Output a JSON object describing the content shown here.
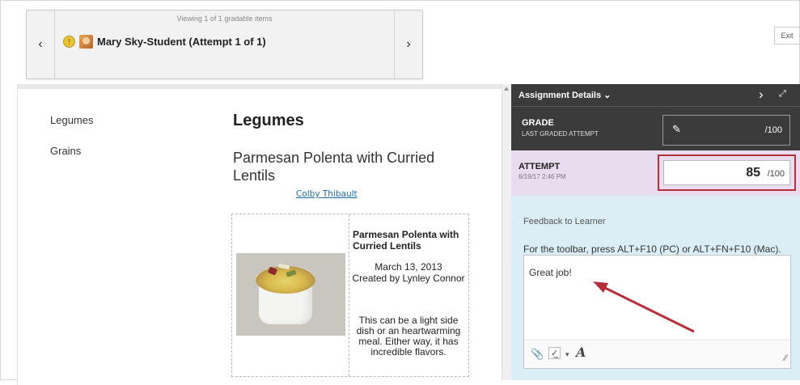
{
  "navigator": {
    "viewing_text": "Viewing 1 of 1 gradable items",
    "student_name": "Mary Sky-Student (Attempt 1 of 1)",
    "prev_icon": "‹",
    "next_icon": "›"
  },
  "exit_label": "Exit",
  "document": {
    "side_links": [
      "Legumes",
      "Grains"
    ],
    "title": "Legumes",
    "subtitle": "Parmesan Polenta with Curried Lentils",
    "author": "Colby Thibault",
    "recipe": {
      "name": "Parmesan Polenta with Curried Lentils",
      "date": "March 13, 2013",
      "created_by": "Created by Lynley Connor",
      "description": "This can be a light side dish or an heartwarming meal. Either way, it has incredible flavors."
    }
  },
  "panel": {
    "header_title": "Assignment Details ⌄",
    "grade_label": "GRADE",
    "grade_sub": "LAST GRADED ATTEMPT",
    "grade_max": "/100",
    "attempt_label": "ATTEMPT",
    "attempt_date": "6/19/17 2:46 PM",
    "attempt_score": "85",
    "attempt_max": "/100",
    "feedback_label": "Feedback to Learner",
    "toolbar_hint": "For the toolbar, press ALT+F10 (PC) or ALT+FN+F10 (Mac).",
    "feedback_text": "Great job!"
  },
  "colors": {
    "panel_dark": "#3b3b3b",
    "attempt_bg": "#e9dcef",
    "panel_bg": "#dceef5",
    "highlight_red": "#b6303a",
    "link_blue": "#1c6ca8"
  }
}
